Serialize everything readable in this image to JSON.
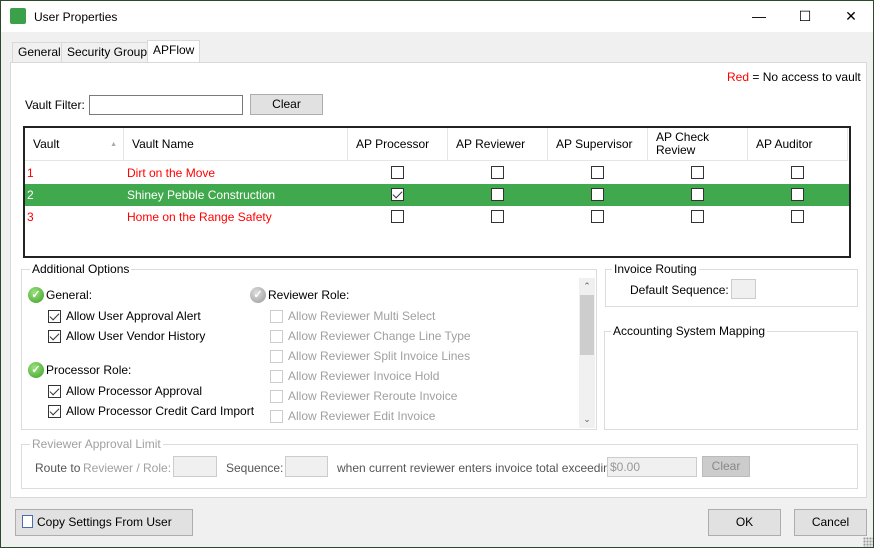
{
  "window": {
    "title": "User Properties",
    "minimize_icon": "minimize-icon",
    "maximize_icon": "maximize-icon",
    "close_icon": "close-icon"
  },
  "tabs": [
    {
      "label": "General"
    },
    {
      "label": "Security Groups"
    },
    {
      "label": "APFlow",
      "active": true
    }
  ],
  "legend": {
    "red_word": "Red",
    "text": "= No access to vault",
    "red_color": "#ff0000"
  },
  "filter": {
    "label": "Vault Filter:",
    "value": "",
    "clear_label": "Clear"
  },
  "grid": {
    "columns": [
      "Vault",
      "Vault Name",
      "AP Processor",
      "AP Reviewer",
      "AP Supervisor",
      "AP Check Review",
      "AP Auditor"
    ],
    "sort_column": "Vault",
    "sort_direction": "ascending",
    "selected_color": "#41a94d",
    "rows": [
      {
        "vault": "1",
        "name": "Dirt on the Move",
        "no_access": true,
        "checks": [
          false,
          false,
          false,
          false,
          false
        ]
      },
      {
        "vault": "2",
        "name": "Shiney Pebble Construction",
        "no_access": false,
        "selected": true,
        "checks": [
          true,
          false,
          false,
          false,
          false
        ]
      },
      {
        "vault": "3",
        "name": "Home on the Range Safety",
        "no_access": true,
        "checks": [
          false,
          false,
          false,
          false,
          false
        ]
      }
    ]
  },
  "options": {
    "title": "Additional Options",
    "general": {
      "label": "General:",
      "items": [
        {
          "label": "Allow User Approval Alert",
          "checked": true
        },
        {
          "label": "Allow User Vendor History",
          "checked": true
        }
      ]
    },
    "processor": {
      "label": "Processor Role:",
      "items": [
        {
          "label": "Allow Processor Approval",
          "checked": true
        },
        {
          "label": "Allow Processor Credit Card Import",
          "checked": true
        }
      ]
    },
    "reviewer": {
      "label": "Reviewer Role:",
      "items": [
        {
          "label": "Allow Reviewer Multi Select",
          "checked": false
        },
        {
          "label": "Allow Reviewer Change Line Type",
          "checked": false
        },
        {
          "label": "Allow Reviewer Split Invoice Lines",
          "checked": false
        },
        {
          "label": "Allow Reviewer Invoice Hold",
          "checked": false
        },
        {
          "label": "Allow Reviewer Reroute Invoice",
          "checked": false
        },
        {
          "label": "Allow Reviewer Edit Invoice",
          "checked": false
        }
      ]
    }
  },
  "routing": {
    "title": "Invoice Routing",
    "default_sequence_label": "Default Sequence:",
    "default_sequence_value": ""
  },
  "mapping": {
    "title": "Accounting System Mapping"
  },
  "limit": {
    "title": "Reviewer Approval Limit",
    "route_to": "Route to",
    "reviewer_role": "Reviewer / Role:",
    "reviewer_value": "",
    "sequence_label": "Sequence:",
    "sequence_value": "",
    "exceeding_label": "when current reviewer enters invoice total exceeding:",
    "amount": "$0.00",
    "clear_label": "Clear"
  },
  "footer": {
    "copy_label": "Copy Settings From User",
    "ok_label": "OK",
    "cancel_label": "Cancel"
  }
}
